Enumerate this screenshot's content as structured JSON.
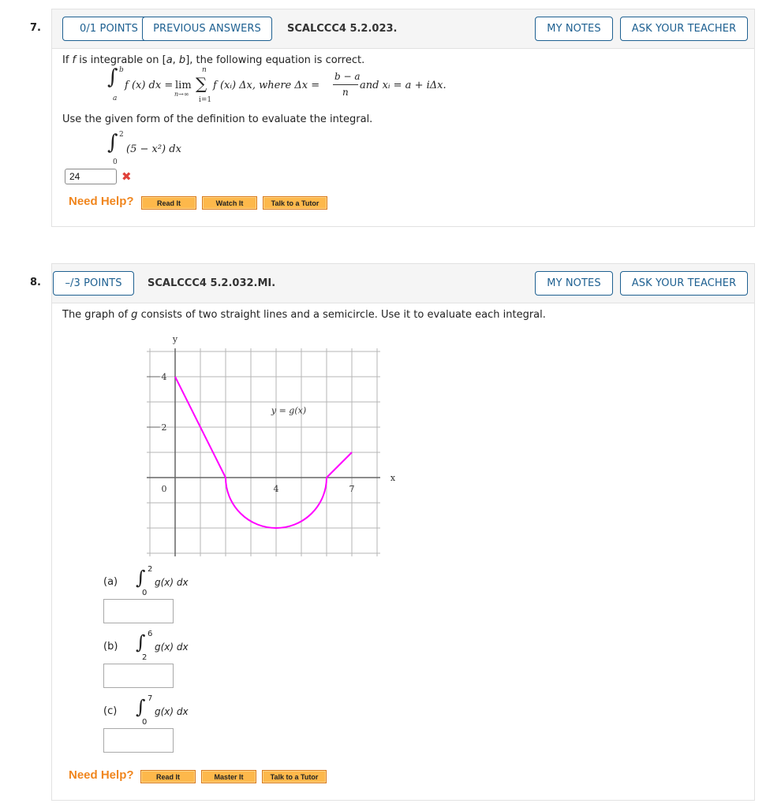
{
  "questions": [
    {
      "number": "7.",
      "points_label": "0/1 POINTS",
      "previous_answers_label": "PREVIOUS ANSWERS",
      "code": "SCALCCC4 5.2.023.",
      "my_notes_label": "MY NOTES",
      "ask_teacher_label": "ASK YOUR TEACHER",
      "intro_parts": {
        "p1": "If ",
        "f": "f",
        "p2": " is integrable on [",
        "a": "a",
        "comma": ", ",
        "b": "b",
        "p3": "], the following equation is correct."
      },
      "definition": {
        "upper": "b",
        "lower": "a",
        "integrand": "f (x) dx = ",
        "lim": "lim",
        "lim_sub": "n→∞",
        "sum_upper": "n",
        "sum_lower": "i=1",
        "sum_body": "f (xᵢ) Δx, where Δx = ",
        "frac_num": "b − a",
        "frac_den": "n",
        "tail": " and xᵢ = a + iΔx."
      },
      "instruction": "Use the given form of the definition to evaluate the integral.",
      "integral": {
        "upper": "2",
        "lower": "0",
        "body": "(5 − x²) dx"
      },
      "answer_value": "24",
      "answer_status": "incorrect",
      "answer_status_icon": "x-mark-icon",
      "need_help_label": "Need Help?",
      "help_buttons": [
        "Read It",
        "Watch It",
        "Talk to a Tutor"
      ]
    },
    {
      "number": "8.",
      "points_label": "–/3 POINTS",
      "code": "SCALCCC4 5.2.032.MI.",
      "my_notes_label": "MY NOTES",
      "ask_teacher_label": "ASK YOUR TEACHER",
      "prompt_parts": {
        "p1": "The graph of ",
        "g": "g",
        "p2": " consists of two straight lines and a semicircle. Use it to evaluate each integral."
      },
      "graph": {
        "y_axis_label": "y",
        "x_axis_label": "x",
        "curve_label": "y = g(x)",
        "y_ticks": [
          "4",
          "2"
        ],
        "x_ticks": [
          "0",
          "4",
          "7"
        ],
        "curve_color": "#ff00ff"
      },
      "parts": [
        {
          "label": "(a)",
          "lower": "0",
          "upper": "2",
          "body": "g(x) dx",
          "value": ""
        },
        {
          "label": "(b)",
          "lower": "2",
          "upper": "6",
          "body": "g(x) dx",
          "value": ""
        },
        {
          "label": "(c)",
          "lower": "0",
          "upper": "7",
          "body": "g(x) dx",
          "value": ""
        }
      ],
      "need_help_label": "Need Help?",
      "help_buttons": [
        "Read It",
        "Master It",
        "Talk to a Tutor"
      ]
    }
  ],
  "chart_data": {
    "type": "line",
    "title": "y = g(x)",
    "xlabel": "x",
    "ylabel": "y",
    "x_tick_labels": [
      "0",
      "4",
      "7"
    ],
    "y_tick_labels": [
      "2",
      "4"
    ],
    "xlim": [
      -1,
      8
    ],
    "ylim": [
      -3,
      5
    ],
    "grid": true,
    "segments": [
      {
        "kind": "line",
        "from": [
          0,
          4
        ],
        "to": [
          2,
          0
        ]
      },
      {
        "kind": "semicircle",
        "center": [
          4,
          0
        ],
        "radius": 2,
        "side": "below"
      },
      {
        "kind": "line",
        "from": [
          6,
          0
        ],
        "to": [
          7,
          1
        ]
      }
    ]
  }
}
